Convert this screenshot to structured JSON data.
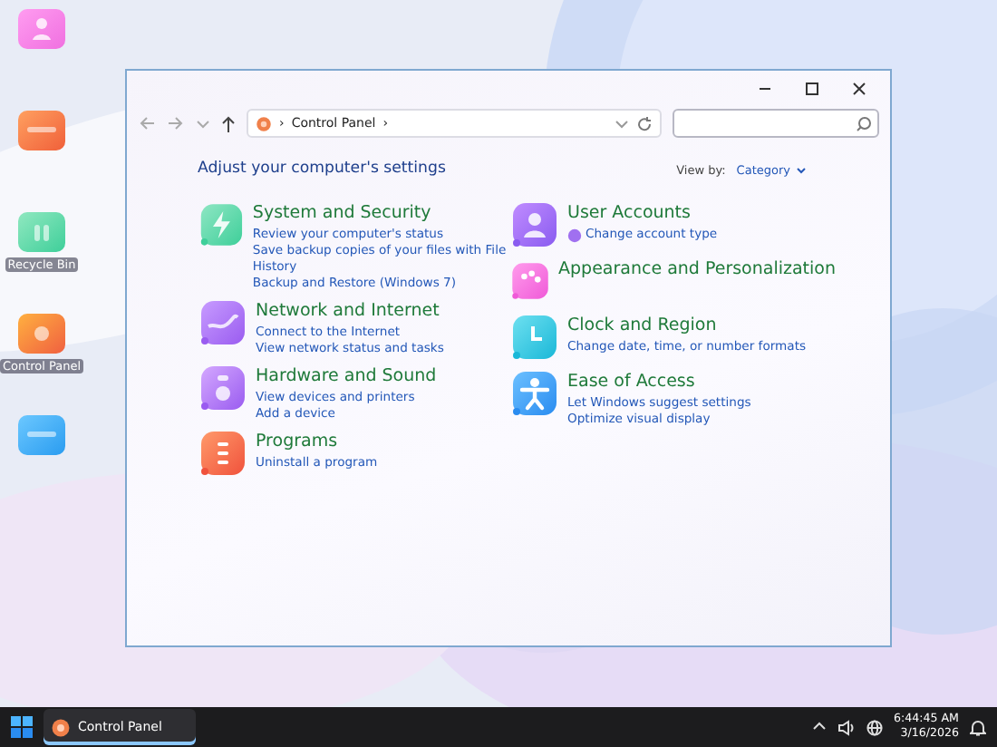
{
  "desktop_icons": [
    {
      "kind": "user"
    },
    {
      "kind": "monitor"
    },
    {
      "kind": "bin",
      "label": "Recycle Bin"
    },
    {
      "kind": "gear",
      "label": "Control Panel"
    },
    {
      "kind": "folder"
    }
  ],
  "window": {
    "address": "Control Panel",
    "separator": "›",
    "heading": "Adjust your computer's settings",
    "view_by_label": "View by:",
    "view_by_value": "Category",
    "columns": [
      [
        {
          "title": "System and Security",
          "links": [
            {
              "text": "Review your computer's status",
              "shield": false
            },
            {
              "text": "Save backup copies of your files with File History",
              "shield": false
            },
            {
              "text": "Backup and Restore (Windows 7)",
              "shield": false
            }
          ]
        },
        {
          "title": "Network and Internet",
          "links": [
            {
              "text": "Connect to the Internet",
              "shield": false
            },
            {
              "text": "View network status and tasks",
              "shield": false
            }
          ]
        },
        {
          "title": "Hardware and Sound",
          "links": [
            {
              "text": "View devices and printers",
              "shield": false
            },
            {
              "text": "Add a device",
              "shield": false
            }
          ]
        },
        {
          "title": "Programs",
          "links": [
            {
              "text": "Uninstall a program",
              "shield": false
            }
          ]
        }
      ],
      [
        {
          "title": "User Accounts",
          "links": [
            {
              "text": "Change account type",
              "shield": true
            }
          ]
        },
        {
          "title": "Appearance and Personalization"
        },
        {
          "title": "Clock and Region",
          "links": [
            {
              "text": "Change date, time, or number formats",
              "shield": false
            }
          ]
        },
        {
          "title": "Ease of Access",
          "links": [
            {
              "text": "Let Windows suggest settings",
              "shield": false
            },
            {
              "text": "Optimize visual display",
              "shield": false
            }
          ]
        }
      ]
    ]
  },
  "taskbar": {
    "apps": [
      {
        "label": "Control Panel",
        "selected": true
      }
    ],
    "time": "6:44:45 AM",
    "date": "3/16/2026"
  }
}
